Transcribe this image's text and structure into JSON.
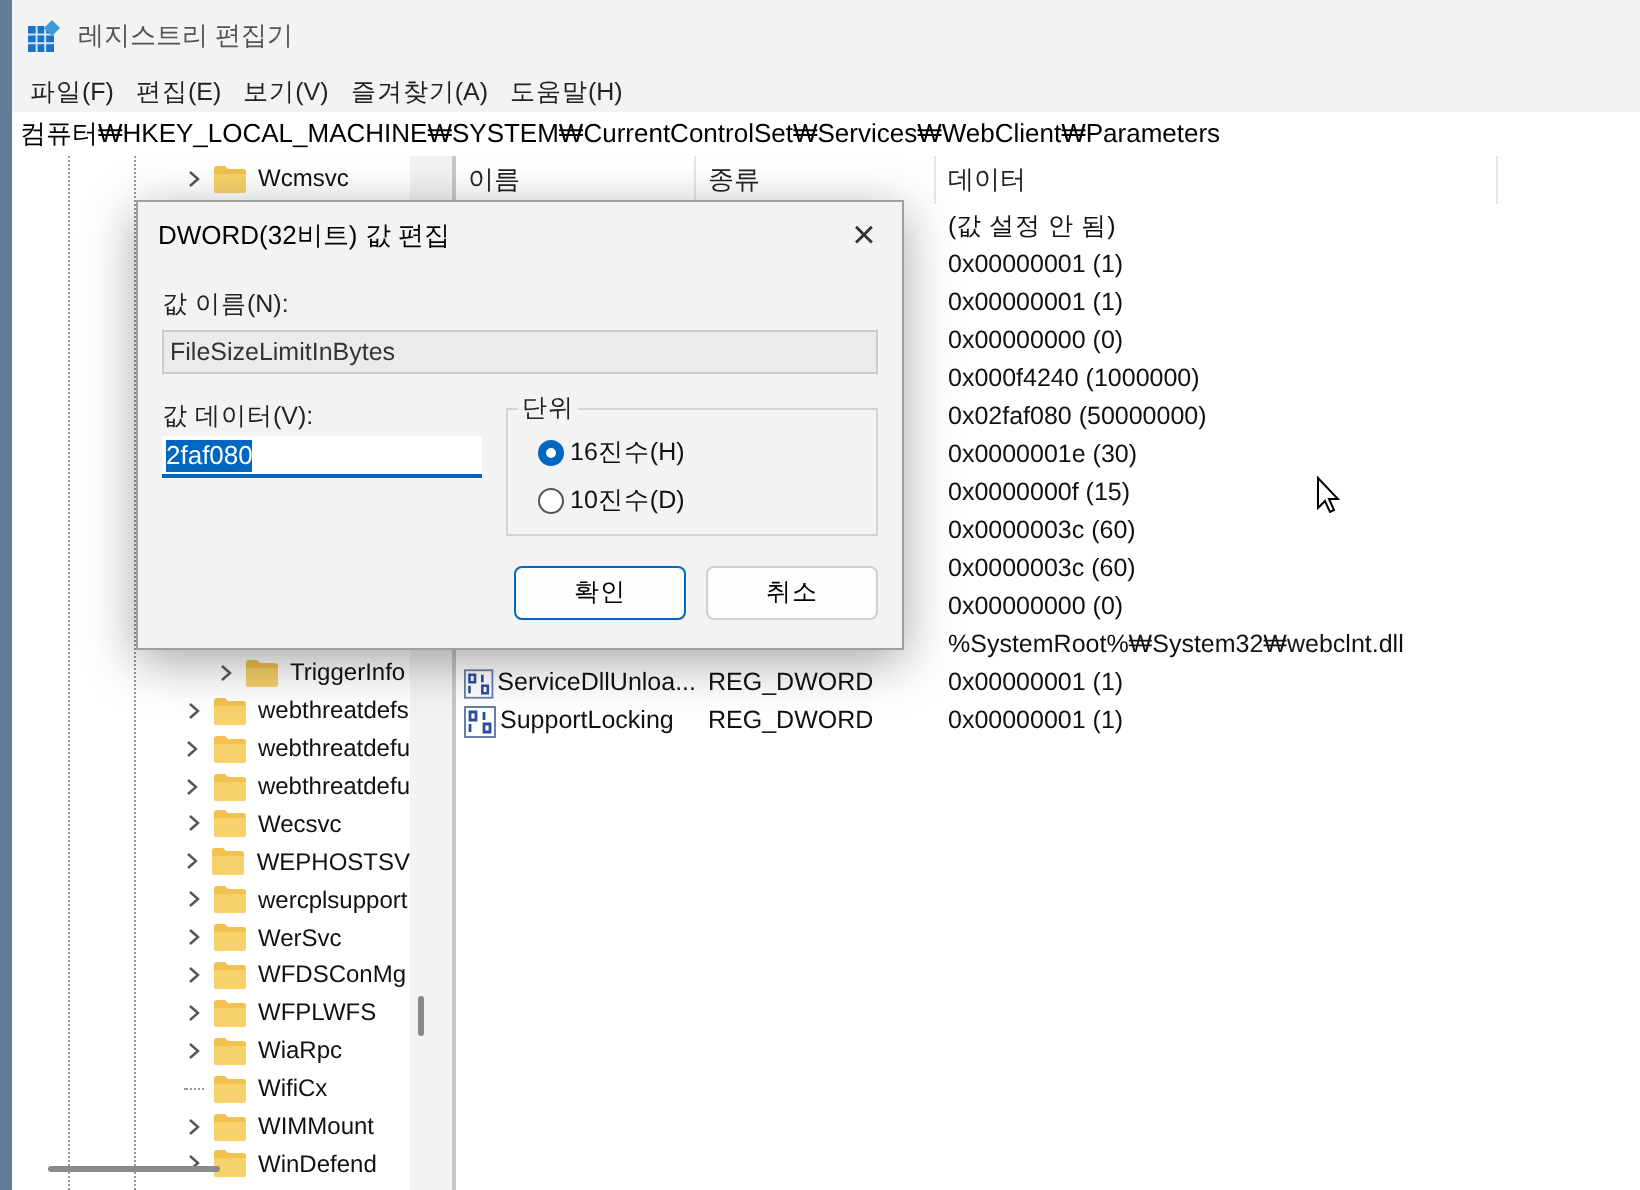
{
  "window": {
    "title": "레지스트리 편집기"
  },
  "menu": [
    "파일(F)",
    "편집(E)",
    "보기(V)",
    "즐겨찾기(A)",
    "도움말(H)"
  ],
  "address": "컴퓨터₩HKEY_LOCAL_MACHINE₩SYSTEM₩CurrentControlSet₩Services₩WebClient₩Parameters",
  "tree": {
    "items_top": [
      {
        "label": "Wcmsvc",
        "expandable": true
      }
    ],
    "children_visible": [
      {
        "label": "TriggerInfo",
        "expandable": true
      }
    ],
    "items": [
      {
        "label": "webthreatdefs",
        "expandable": true
      },
      {
        "label": "webthreatdefu",
        "expandable": true
      },
      {
        "label": "webthreatdefu",
        "expandable": true
      },
      {
        "label": "Wecsvc",
        "expandable": true
      },
      {
        "label": "WEPHOSTSV",
        "expandable": true
      },
      {
        "label": "wercplsupport",
        "expandable": true
      },
      {
        "label": "WerSvc",
        "expandable": true
      },
      {
        "label": "WFDSConMg",
        "expandable": true
      },
      {
        "label": "WFPLWFS",
        "expandable": true
      },
      {
        "label": "WiaRpc",
        "expandable": true
      },
      {
        "label": "WifiCx",
        "expandable": false
      },
      {
        "label": "WIMMount",
        "expandable": true
      },
      {
        "label": "WinDefend",
        "expandable": true
      }
    ]
  },
  "list": {
    "columns": [
      "이름",
      "종류",
      "데이터"
    ],
    "rows": [
      {
        "data": "(값 설정 안 됨)"
      },
      {
        "data": "0x00000001 (1)"
      },
      {
        "data": "0x00000001 (1)"
      },
      {
        "data": "0x00000000 (0)"
      },
      {
        "data": "0x000f4240 (1000000)"
      },
      {
        "data": "0x02faf080 (50000000)"
      },
      {
        "data": "0x0000001e (30)"
      },
      {
        "data": "0x0000000f (15)"
      },
      {
        "data": "0x0000003c (60)"
      },
      {
        "data": "0x0000003c (60)"
      },
      {
        "data": "0x00000000 (0)"
      },
      {
        "data": "%SystemRoot%₩System32₩webclnt.dll"
      },
      {
        "name": "ServiceDllUnloa...",
        "type": "REG_DWORD",
        "data": "0x00000001 (1)"
      },
      {
        "name": "SupportLocking",
        "type": "REG_DWORD",
        "data": "0x00000001 (1)"
      }
    ]
  },
  "dialog": {
    "title": "DWORD(32비트) 값 편집",
    "close": "×",
    "name_label": "값 이름(N):",
    "name_value": "FileSizeLimitInBytes",
    "data_label": "값 데이터(V):",
    "data_value": "2faf080",
    "base_group": "단위",
    "bases": [
      {
        "label": "16진수(H)",
        "selected": true
      },
      {
        "label": "10진수(D)",
        "selected": false
      }
    ],
    "buttons": [
      "확인",
      "취소"
    ]
  }
}
